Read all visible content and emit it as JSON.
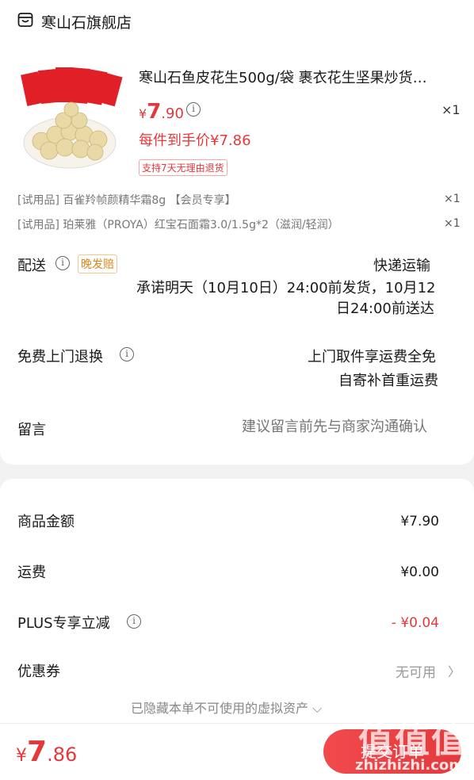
{
  "shop": {
    "name": "寒山石旗舰店",
    "icon": "store-icon"
  },
  "product": {
    "title": "寒山石鱼皮花生500g/袋 裹衣花生坚果炒货…",
    "price_symbol": "¥",
    "price_int": "7",
    "price_dec": ".90",
    "qty": "×1",
    "final_price": "每件到手价¥7.86",
    "return_tag": "支持7天无理由退货"
  },
  "trials": [
    {
      "text": "[试用品]   百雀羚帧颜精华霜8g 【会员专享】",
      "qty": "×1"
    },
    {
      "text": "[试用品]   珀莱雅（PROYA）红宝石面霜3.0/1.5g*2（滋润/轻润）",
      "qty": "×1"
    }
  ],
  "shipping": {
    "label": "配送",
    "tag": "晚发赔",
    "method": "快递运输",
    "promise_line1": "承诺明天（10月10日）24:00前发货，10月12",
    "promise_line2": "日24:00前送达"
  },
  "returns": {
    "label": "免费上门退换",
    "line1": "上门取件享运费全免",
    "line2": "自寄补首重运费"
  },
  "message": {
    "label": "留言",
    "placeholder": "建议留言前先与商家沟通确认"
  },
  "summary": {
    "goods_label": "商品金额",
    "goods_value": "¥7.90",
    "freight_label": "运费",
    "freight_value": "¥0.00",
    "plus_label": "PLUS专享立减",
    "plus_value": "- ¥0.04",
    "coupon_label": "优惠券",
    "coupon_value": "无可用",
    "hidden_note": "已隐藏本单不可使用的虚拟资产 ⌵"
  },
  "footer": {
    "total_symbol": "¥",
    "total_int": "7",
    "total_dec": ".86",
    "submit_label": "提交订单",
    "watermark": "值值值",
    "watermark_url": "zhizhizhi.com"
  },
  "colors": {
    "accent": "#e4393c",
    "tag_orange": "#d9861a",
    "muted": "#999999"
  }
}
